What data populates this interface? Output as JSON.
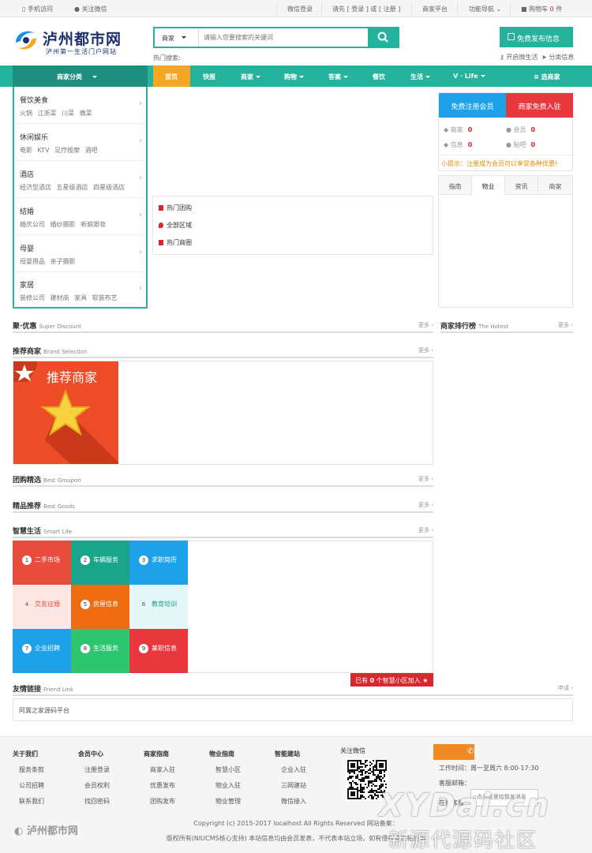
{
  "topbar": {
    "mobile": "手机访问",
    "wechat": "关注微信",
    "wx_login": "微信登录",
    "login_prefix": "请先 [",
    "login": "登录",
    "or": "] 或 [",
    "register": "注册",
    "login_suffix": "]",
    "merchant_platform": "商家平台",
    "nav_menu": "功能导航",
    "cart_label": "购物车",
    "cart_count": "0",
    "cart_unit": "件"
  },
  "logo": {
    "name": "泸州都市网",
    "slogan": "泸州第一生活门户网站"
  },
  "search": {
    "category": "商家",
    "placeholder": "请输入您要搜索的关键词",
    "hot_label": "热门搜索:"
  },
  "header": {
    "publish": "免费发布信息",
    "open_micro": "开启微生活",
    "classified": "分类信息"
  },
  "nav": {
    "category_btn": "商家分类",
    "items": [
      "首页",
      "快报",
      "商家",
      "购物",
      "答案",
      "餐饮",
      "生活",
      "V · Life"
    ],
    "right": "选商家"
  },
  "categories": [
    {
      "title": "餐饮美食",
      "subs": "火锅 江浙菜 川菜 微菜"
    },
    {
      "title": "休闲娱乐",
      "subs": "电影 KTV 足疗按摩 酒吧"
    },
    {
      "title": "酒店",
      "subs": "经济型酒店 五星级酒店 四星级酒店"
    },
    {
      "title": "结婚",
      "subs": "婚庆公司 婚纱摄影 新娘跟妆"
    },
    {
      "title": "母婴",
      "subs": "母婴用品 亲子摄影"
    },
    {
      "title": "家居",
      "subs": "装修公司 建材商 家具 软装布艺"
    }
  ],
  "middle_links": [
    "热门团购",
    "全部区域",
    "热门商圈"
  ],
  "right_panel": {
    "register": "免费注册会员",
    "merchant_join": "商家免费入驻",
    "stats": [
      {
        "label": "商家",
        "value": "0"
      },
      {
        "label": "会员",
        "value": "0"
      },
      {
        "label": "信息",
        "value": "0"
      },
      {
        "label": "贴吧",
        "value": "0"
      }
    ],
    "tip": "小提示：注册成为会员可以享受各种优惠!",
    "tabs": [
      "指南",
      "物业",
      "资讯",
      "商家"
    ]
  },
  "sections": {
    "discount": {
      "title": "聚·优惠",
      "en": "Super Discount",
      "more": "更多 ›"
    },
    "ranking": {
      "title": "商家排行榜",
      "en": "The Hotest",
      "more": "更多 ›"
    },
    "recommend": {
      "title": "推荐商家",
      "en": "Brand Selection",
      "more": "更多 ›",
      "banner": "推荐商家"
    },
    "groupon": {
      "title": "团购精选",
      "en": "Best Groupon",
      "more": "更多 ›"
    },
    "goods": {
      "title": "精品推荐",
      "en": "Best Goods",
      "more": "更多 ›"
    },
    "smart": {
      "title": "智慧生活",
      "en": "Smart Life",
      "more": "更多 ›"
    },
    "friend": {
      "title": "友情链接",
      "en": "Friend Link",
      "more": "申请 ›",
      "link": "阿冀之家源码平台"
    }
  },
  "smart_tiles": [
    {
      "n": "1",
      "label": "二手市场",
      "bg": "#e84c3d"
    },
    {
      "n": "2",
      "label": "车辆服务",
      "bg": "#1aa58a"
    },
    {
      "n": "3",
      "label": "求职简历",
      "bg": "#1da1e8"
    },
    {
      "n": "4",
      "label": "交友征婚",
      "bg": "#fde6e4"
    },
    {
      "n": "5",
      "label": "房屋信息",
      "bg": "#ef6c12"
    },
    {
      "n": "6",
      "label": "教育培训",
      "bg": "#e4f6f7"
    },
    {
      "n": "7",
      "label": "企业招聘",
      "bg": "#1da1e8"
    },
    {
      "n": "8",
      "label": "生活服务",
      "bg": "#2ec56f"
    },
    {
      "n": "9",
      "label": "兼职信息",
      "bg": "#e8383d"
    }
  ],
  "smart_bar": {
    "prefix": "已有",
    "count": "0",
    "suffix": "个智慧小区加入"
  },
  "footer": {
    "cols": [
      {
        "title": "关于我们",
        "links": [
          "服务条款",
          "公司招聘",
          "联系我们"
        ]
      },
      {
        "title": "会员中心",
        "links": [
          "注册登录",
          "会员权利",
          "找回密码"
        ]
      },
      {
        "title": "商家指南",
        "links": [
          "商家入驻",
          "优惠发布",
          "团购发布"
        ]
      },
      {
        "title": "物业指南",
        "links": [
          "智慧小区",
          "物业入驻",
          "物业管理"
        ]
      },
      {
        "title": "智能建站",
        "links": [
          "企业入驻",
          "三网建站",
          "微信接入"
        ]
      }
    ],
    "wechat_title": "关注微信",
    "work_time": "工作时间：周一至周六 8:00-17:30",
    "email": "客服邮箱：",
    "qq_alt": "点击这里给我发消息",
    "online": "在线客服",
    "copyright": "Copyright (c) 2015-2017 localhost All Rights Reserved 网站备案：",
    "notice": "版权所有(NIUCMS核心支持) 本站信息均由会员发表，不代表本站立场，如有侵权请发帖投诉"
  },
  "watermark": {
    "en": "XYDai.cn",
    "cn": "新源代源码社区"
  }
}
